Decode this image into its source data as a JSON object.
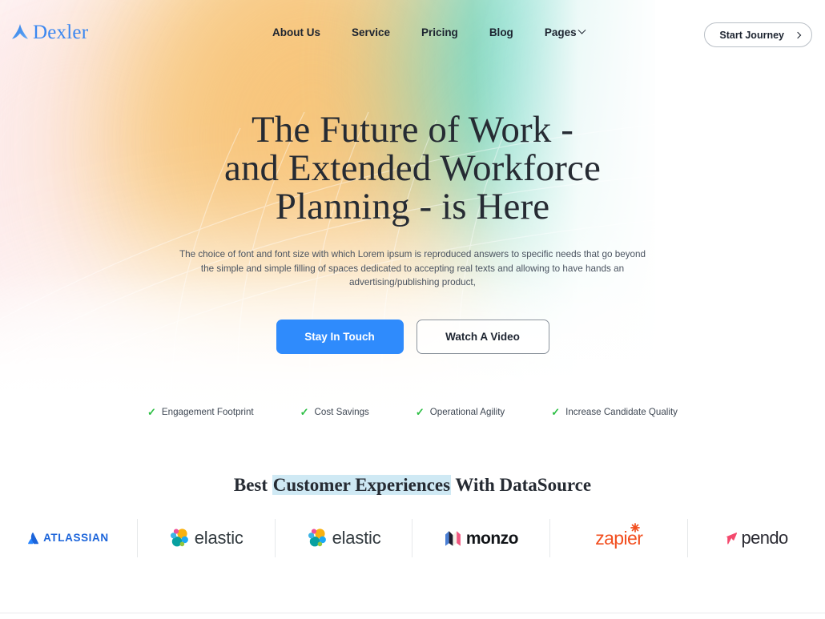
{
  "brand": {
    "name": "Dexler",
    "mark": "arrow-up-logo-icon",
    "color": "#3b87f0"
  },
  "nav": {
    "items": [
      {
        "label": "About Us",
        "has_dropdown": false
      },
      {
        "label": "Service",
        "has_dropdown": false
      },
      {
        "label": "Pricing",
        "has_dropdown": false
      },
      {
        "label": "Blog",
        "has_dropdown": false
      },
      {
        "label": "Pages",
        "has_dropdown": true
      }
    ],
    "cta": {
      "label": "Start Journey",
      "icon": "chevron-right-icon"
    }
  },
  "hero": {
    "title_line1": "The Future of Work -",
    "title_line2": "and Extended Workforce",
    "title_line3": "Planning - is Here",
    "subtitle": "The choice of font and font size with which Lorem ipsum is reproduced answers to specific needs that go beyond the simple and simple filling of spaces dedicated to accepting real texts and allowing to have hands an advertising/publishing product,",
    "primary_button": "Stay In Touch",
    "secondary_button": "Watch A Video",
    "features": [
      {
        "label": "Engagement Footprint",
        "icon": "check-icon"
      },
      {
        "label": "Cost Savings",
        "icon": "check-icon"
      },
      {
        "label": "Operational Agility",
        "icon": "check-icon"
      },
      {
        "label": "Increase Candidate Quality",
        "icon": "check-icon"
      }
    ],
    "accent_color": "#2f8bfc",
    "check_color": "#2bbf43"
  },
  "partners": {
    "title_prefix": "Best ",
    "title_highlight": "Customer Experiences",
    "title_suffix": " With DataSource",
    "highlight_color": "#cfe9f4",
    "logos": [
      {
        "name": "ATLASSIAN",
        "icon": "atlassian-logo-icon"
      },
      {
        "name": "elastic",
        "icon": "elastic-logo-icon"
      },
      {
        "name": "elastic",
        "icon": "elastic-logo-icon"
      },
      {
        "name": "monzo",
        "icon": "monzo-logo-icon"
      },
      {
        "name": "zapier",
        "icon": "zapier-logo-icon"
      },
      {
        "name": "pendo",
        "icon": "pendo-logo-icon"
      }
    ]
  }
}
